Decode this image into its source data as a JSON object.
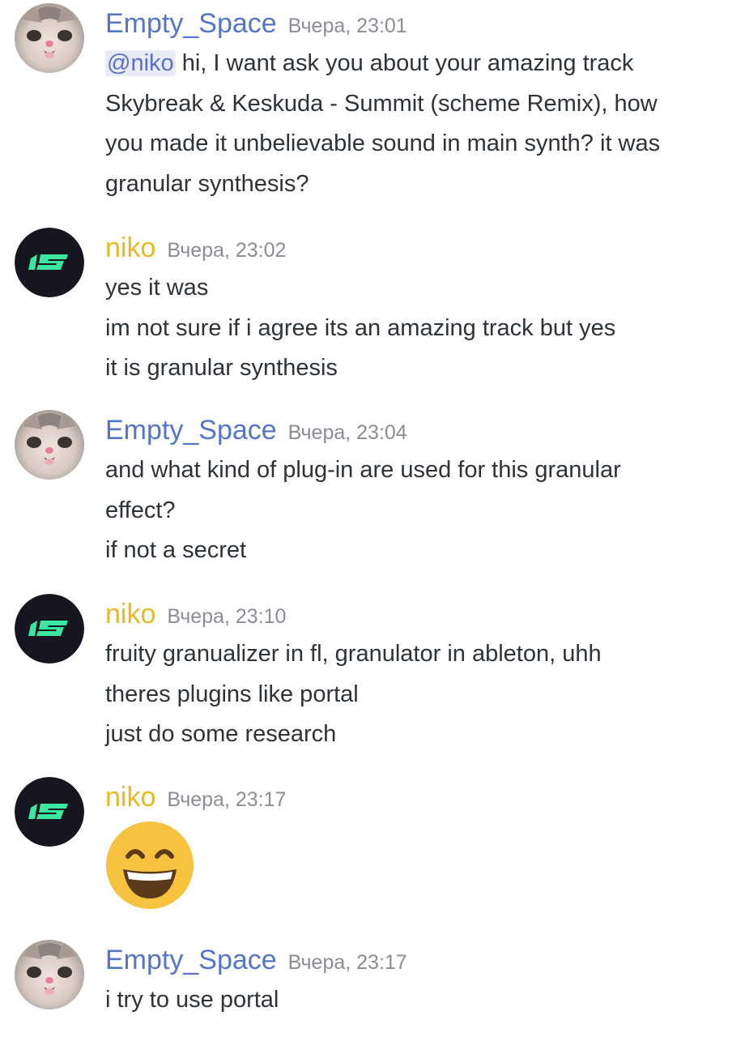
{
  "colors": {
    "empty_space_name": "#5575c9",
    "niko_name": "#e8b920",
    "timestamp": "#8a8e94",
    "text": "#2e3338",
    "mention": "#5a6fc7",
    "mention_bg": "#e8ecf8",
    "niko_avatar_bg": "#15161f",
    "niko_logo": "#3ce5a0"
  },
  "messages": [
    {
      "author": "Empty_Space",
      "avatar": "cat-avatar",
      "timestamp": "Вчера, 23:01",
      "mention": "@niko",
      "lines": [
        " hi, I want ask you about your amazing track",
        "Skybreak & Keskuda - Summit (scheme Remix), how",
        "you made it unbelievable sound in main synth? it was",
        "granular synthesis?"
      ]
    },
    {
      "author": "niko",
      "avatar": "niko-logo-avatar",
      "timestamp": "Вчера, 23:02",
      "lines": [
        "yes it was",
        "im not sure if i agree its an amazing track but yes",
        "it is granular synthesis"
      ]
    },
    {
      "author": "Empty_Space",
      "avatar": "cat-avatar",
      "timestamp": "Вчера, 23:04",
      "lines": [
        "and what kind of plug-in are used for this granular",
        "effect?",
        "if not a secret"
      ]
    },
    {
      "author": "niko",
      "avatar": "niko-logo-avatar",
      "timestamp": "Вчера, 23:10",
      "lines": [
        "fruity granualizer in fl, granulator in ableton, uhh",
        "theres plugins like portal",
        "just do some research"
      ]
    },
    {
      "author": "niko",
      "avatar": "niko-logo-avatar",
      "timestamp": "Вчера, 23:17",
      "emoji": "grinning-smile-emoji",
      "lines": []
    },
    {
      "author": "Empty_Space",
      "avatar": "cat-avatar",
      "timestamp": "Вчера, 23:17",
      "lines": [
        "i try to use portal"
      ]
    }
  ]
}
